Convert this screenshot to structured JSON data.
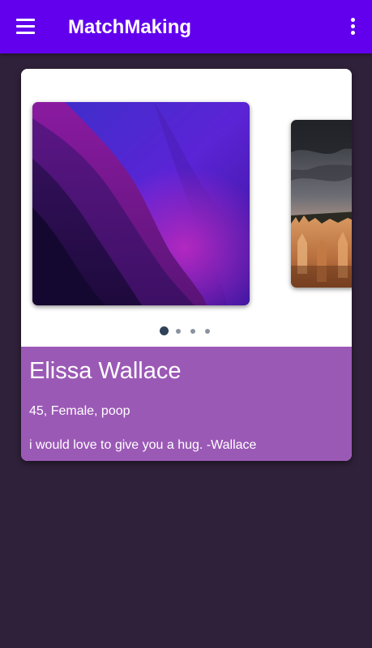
{
  "app_bar": {
    "title": "MatchMaking",
    "menu_icon": "hamburger-menu-icon",
    "more_icon": "more-vert-icon",
    "color": "#6200ee"
  },
  "profile": {
    "name": "Elissa Wallace",
    "details": "45, Female, poop",
    "quote": "i would love to give you a hug. -Wallace",
    "info_color": "#9b59b6"
  },
  "carousel": {
    "slide_count": 4,
    "active_index": 0
  },
  "background_color": "#30213a"
}
